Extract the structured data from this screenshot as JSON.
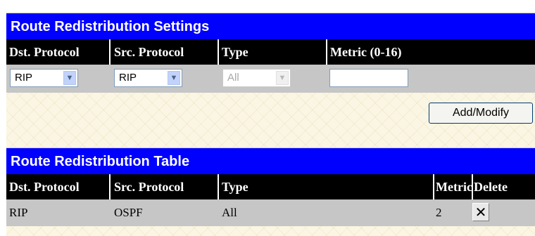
{
  "settings": {
    "title": "Route Redistribution Settings",
    "headers": [
      "Dst. Protocol",
      "Src. Protocol",
      "Type",
      "Metric (0-16)"
    ],
    "dst_protocol_value": "RIP",
    "src_protocol_value": "RIP",
    "type_value": "All",
    "metric_value": "",
    "add_modify_label": "Add/Modify"
  },
  "table": {
    "title": "Route Redistribution Table",
    "headers": [
      "Dst. Protocol",
      "Src. Protocol",
      "Type",
      "Metric",
      "Delete"
    ],
    "rows": [
      {
        "dst": "RIP",
        "src": "OSPF",
        "type": "All",
        "metric": "2"
      }
    ],
    "delete_glyph": "✕"
  },
  "icons": {
    "dropdown": "chevron-down-icon",
    "delete": "delete-x-icon"
  },
  "colors": {
    "title_bar": "#0000ff",
    "header_bar": "#000000",
    "row_bg": "#c6c6c6",
    "page_bg": "#fbf6e3"
  }
}
